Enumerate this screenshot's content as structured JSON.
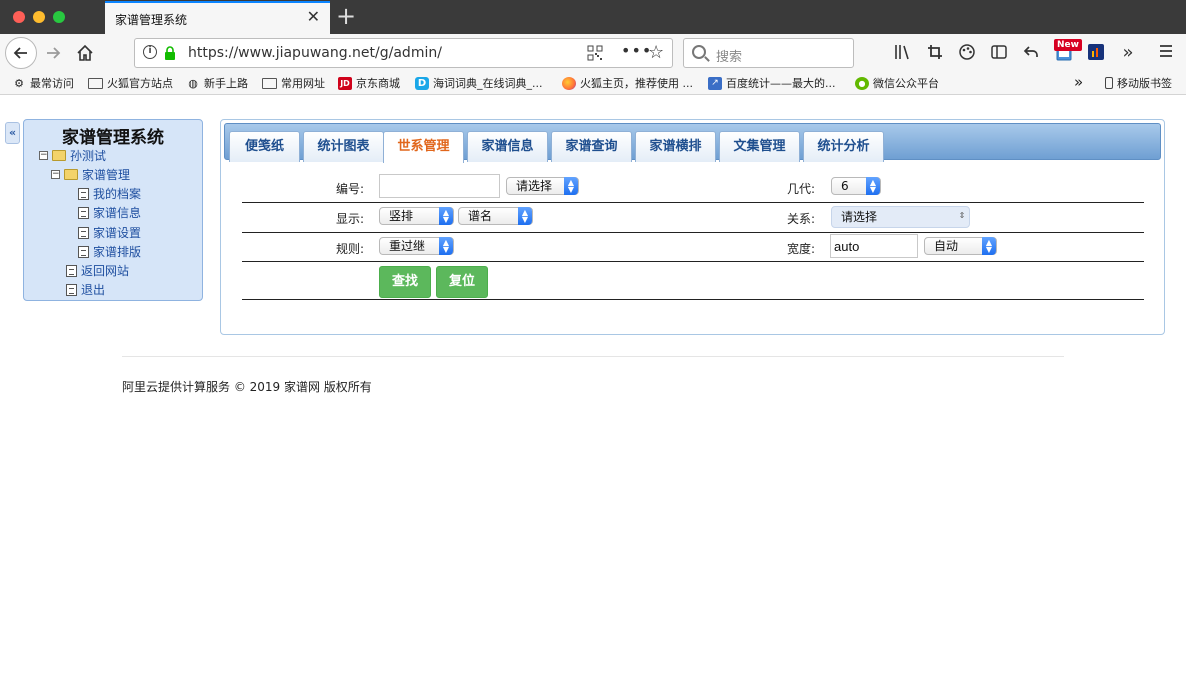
{
  "browser": {
    "tab_title": "家谱管理系统",
    "tab_close": "✕",
    "new_tab": "+",
    "url": "https://www.jiapuwang.net/g/admin/",
    "search_placeholder": "搜索",
    "new_badge": "New",
    "more_actions": "•••"
  },
  "bookmarks": [
    {
      "label": "最常访问",
      "icon": "gear-icon"
    },
    {
      "label": "火狐官方站点",
      "icon": "folder-icon"
    },
    {
      "label": "新手上路",
      "icon": "globe-icon"
    },
    {
      "label": "常用网址",
      "icon": "folder-icon"
    },
    {
      "label": "京东商城",
      "icon": "jd-icon",
      "icon_text": "JD"
    },
    {
      "label": "海词词典_在线词典_...",
      "icon": "haici-icon",
      "icon_text": "D"
    },
    {
      "label": "火狐主页，推荐使用 ...",
      "icon": "firefox-icon"
    },
    {
      "label": "百度统计——最大的...",
      "icon": "baidu-tongji-icon"
    },
    {
      "label": "微信公众平台",
      "icon": "wechat-icon"
    }
  ],
  "bookmarks_overflow": "»",
  "mobile_bookmarks": "移动版书签",
  "sidebar": {
    "collapse": "«",
    "title": "家谱管理系统",
    "tree": {
      "root": "孙测试",
      "group": "家谱管理",
      "group_items": [
        "我的档案",
        "家谱信息",
        "家谱设置",
        "家谱排版"
      ],
      "links": [
        "返回网站",
        "退出"
      ]
    }
  },
  "main": {
    "tabs": [
      "便笺纸",
      "统计图表",
      "世系管理",
      "家谱信息",
      "家谱查询",
      "家谱横排",
      "文集管理",
      "统计分析"
    ],
    "active_tab": "世系管理",
    "form": {
      "id_label": "编号:",
      "id_value": "",
      "id_select": "请选择",
      "generation_label": "几代:",
      "generation_value": "6",
      "display_label": "显示:",
      "display_mode": "竖排",
      "display_name": "谱名",
      "relation_label": "关系:",
      "relation_value": "请选择",
      "rule_label": "规则:",
      "rule_value": "重过继",
      "width_label": "宽度:",
      "width_value": "auto",
      "width_select": "自动",
      "search_button": "查找",
      "reset_button": "复位"
    }
  },
  "footer": "阿里云提供计算服务 © 2019 家谱网 版权所有",
  "colors": {
    "tab_active_text": "#e1661b",
    "tab_text": "#1f4f8f",
    "button_green": "#5cb85c",
    "sidebar_bg": "#d6e5f8"
  }
}
